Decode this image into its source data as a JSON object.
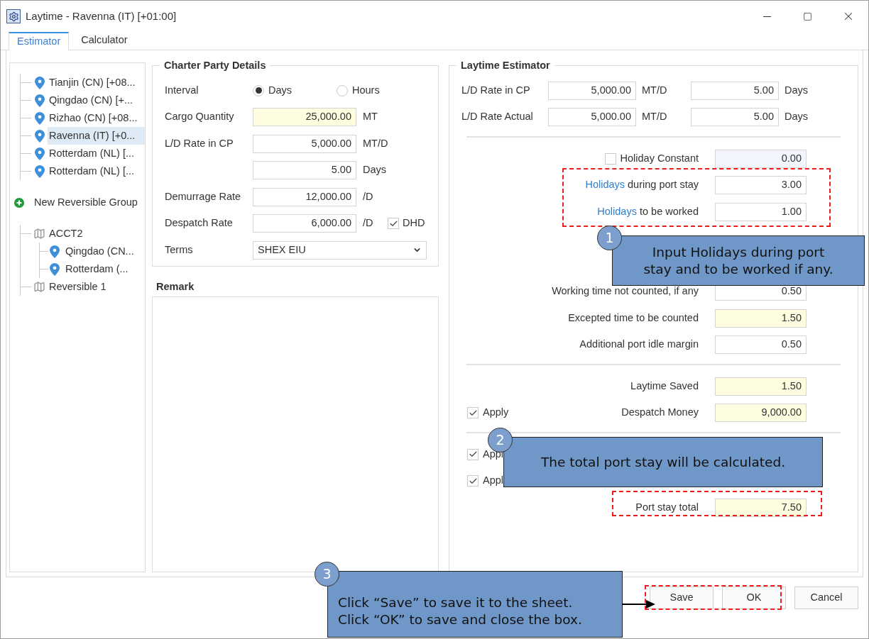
{
  "window": {
    "title": "Laytime - Ravenna (IT) [+01:00]"
  },
  "tabs": [
    {
      "label": "Estimator",
      "selected": true
    },
    {
      "label": "Calculator",
      "selected": false
    }
  ],
  "ports": [
    {
      "label": "Tianjin (CN) [+08...",
      "selected": false
    },
    {
      "label": "Qingdao (CN) [+...",
      "selected": false
    },
    {
      "label": "Rizhao (CN) [+08...",
      "selected": false
    },
    {
      "label": "Ravenna (IT) [+0...",
      "selected": true
    },
    {
      "label": "Rotterdam (NL) [...",
      "selected": false
    },
    {
      "label": "Rotterdam (NL) [...",
      "selected": false
    }
  ],
  "new_group": "New Reversible Group",
  "groups": [
    {
      "label": "ACCT2",
      "children": [
        {
          "label": "Qingdao (CN...",
          "selected": false
        },
        {
          "label": "Rotterdam (...",
          "selected": false
        }
      ]
    },
    {
      "label": "Reversible 1"
    }
  ],
  "charter_party": {
    "title": "Charter Party Details",
    "rows": [
      {
        "kind": "radio",
        "label": "Interval",
        "options": [
          {
            "label": "Days",
            "selected": true
          },
          {
            "label": "Hours",
            "selected": false
          }
        ]
      },
      {
        "kind": "field",
        "label": "Cargo Quantity",
        "value": "25,000.00",
        "unit": "MT",
        "highlighted": true
      },
      {
        "kind": "field",
        "label": "L/D Rate in CP",
        "value": "5,000.00",
        "unit": "MT/D",
        "highlighted": false
      },
      {
        "kind": "field",
        "value": "5.00",
        "unit": "Days",
        "highlighted": false
      },
      {
        "kind": "field",
        "label": "Demurrage Rate",
        "value": "12,000.00",
        "unit": "/D",
        "highlighted": false
      },
      {
        "kind": "field",
        "label": "Despatch Rate",
        "value": "6,000.00",
        "unit": "/D",
        "highlighted": false,
        "check": {
          "label": "DHD",
          "checked": true
        }
      },
      {
        "kind": "select",
        "label": "Terms",
        "value": "SHEX EIU"
      }
    ]
  },
  "remark": {
    "title": "Remark"
  },
  "estimator": {
    "title": "Laytime Estimator",
    "rates": [
      {
        "label": "L/D Rate in CP",
        "value": "5,000.00",
        "unit": "MT/D",
        "days": "5.00",
        "days_unit": "Days"
      },
      {
        "label": "L/D Rate Actual",
        "value": "5,000.00",
        "unit": "MT/D",
        "days": "5.00",
        "days_unit": "Days"
      }
    ],
    "sections": [
      {
        "divider_before": true,
        "rows": [
          {
            "label": "Holiday Constant",
            "value": "0.00",
            "highlighted": false,
            "disabled": true,
            "check": {
              "checked": false
            }
          },
          {
            "link": "Holidays",
            "label": "during port stay",
            "value": "3.00",
            "highlighted": false
          },
          {
            "link": "Holidays",
            "label": "to be worked",
            "value": "1.00",
            "highlighted": false
          }
        ]
      },
      {
        "divider_before": false,
        "rows": [
          {
            "label": "Working time not counted, if any",
            "value": "0.50",
            "highlighted": false
          },
          {
            "label": "Excepted time to be counted",
            "value": "1.50",
            "highlighted": true
          },
          {
            "label": "Additional port idle margin",
            "value": "0.50",
            "highlighted": false
          }
        ]
      },
      {
        "divider_before": true,
        "rows": [
          {
            "label": "Laytime Saved",
            "value": "1.50",
            "highlighted": true
          },
          {
            "label": "Despatch Money",
            "value": "9,000.00",
            "highlighted": true,
            "apply": {
              "label": "Apply",
              "checked": true
            }
          }
        ]
      },
      {
        "divider_before": true,
        "rows": [
          {
            "apply": {
              "label": "Appl",
              "checked": true
            }
          },
          {
            "apply": {
              "label": "Appl",
              "checked": true
            }
          },
          {
            "label": "Port stay total",
            "value": "7.50",
            "highlighted": true
          }
        ]
      }
    ]
  },
  "buttons": [
    {
      "label": "Save"
    },
    {
      "label": "OK"
    },
    {
      "label": "Cancel"
    }
  ],
  "callouts": [
    {
      "number": "1",
      "lines": [
        "Input Holidays during port",
        "stay and to be worked if any."
      ]
    },
    {
      "number": "2",
      "lines": [
        "The total port stay will be calculated."
      ]
    },
    {
      "number": "3",
      "lines": [
        "Click “Save” to save it to the sheet.",
        "Click “OK” to save and close the box."
      ]
    }
  ]
}
